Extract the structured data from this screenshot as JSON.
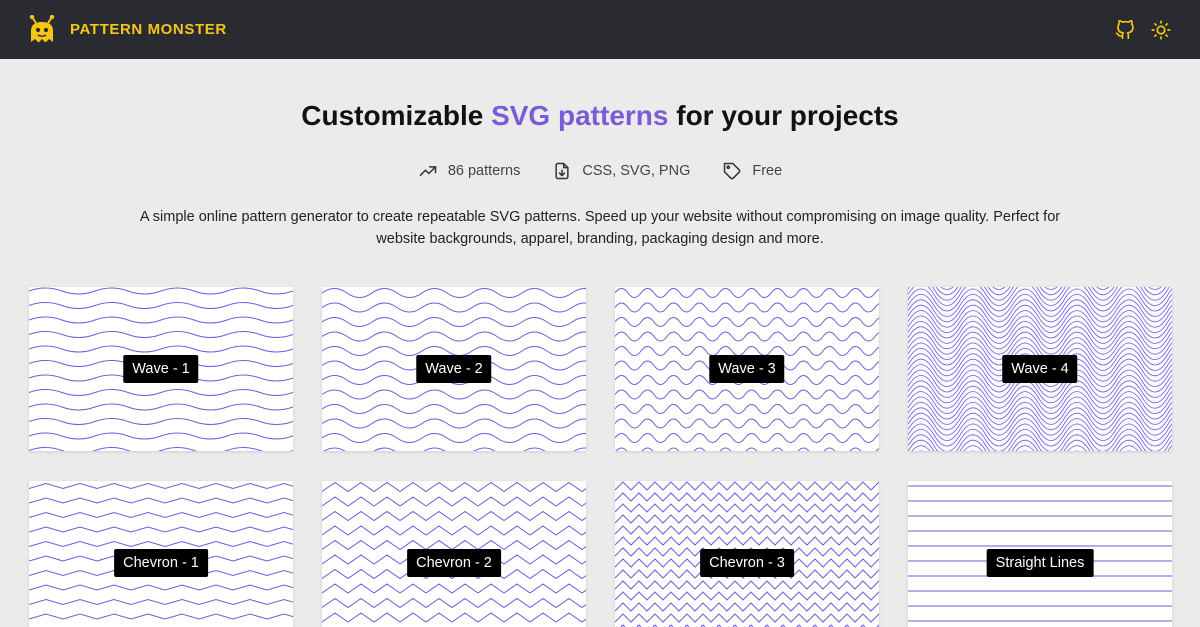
{
  "header": {
    "brand": "PATTERN MONSTER",
    "actions": [
      {
        "name": "github-icon"
      },
      {
        "name": "sun-icon"
      }
    ],
    "colors": {
      "background": "#2a2b30",
      "brand": "#f5c518"
    }
  },
  "hero": {
    "title_prefix": "Customizable ",
    "title_accent": "SVG patterns",
    "title_suffix": " for your projects",
    "accent_color": "#7a5cd6"
  },
  "stats": [
    {
      "icon": "trending-up-icon",
      "label": "86 patterns"
    },
    {
      "icon": "file-download-icon",
      "label": "CSS, SVG, PNG"
    },
    {
      "icon": "tag-icon",
      "label": "Free"
    }
  ],
  "description": "A simple online pattern generator to create repeatable SVG patterns. Speed up your website without compromising on image quality. Perfect for website backgrounds, apparel, branding, packaging design and more.",
  "patterns": [
    {
      "label": "Wave - 1"
    },
    {
      "label": "Wave - 2"
    },
    {
      "label": "Wave - 3"
    },
    {
      "label": "Wave - 4"
    },
    {
      "label": "Chevron - 1"
    },
    {
      "label": "Chevron - 2"
    },
    {
      "label": "Chevron - 3"
    },
    {
      "label": "Straight Lines"
    }
  ],
  "pattern_color": "#6d5ae0"
}
